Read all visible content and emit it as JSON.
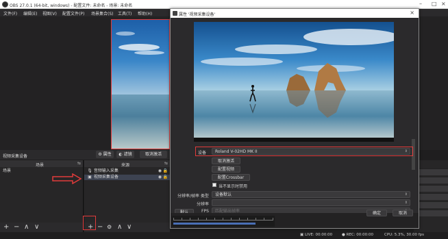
{
  "window": {
    "title": "OBS 27.0.1 (64-bit, windows) - 配置文件: 未命名 - 场景: 未命名"
  },
  "menu": [
    "文件(F)",
    "编辑(E)",
    "视图(V)",
    "配置文件(P)",
    "场景集合(S)",
    "工具(T)",
    "帮助(H)"
  ],
  "source_bar": {
    "label": "视频采集设备",
    "properties": "属性",
    "filters": "滤镜",
    "deactivate": "取消激活"
  },
  "scenes": {
    "header": "场景",
    "items": [
      "场景"
    ],
    "footer": [
      "+",
      "−",
      "∧",
      "∨"
    ]
  },
  "sources": {
    "header": "来源",
    "items": [
      {
        "label": "音频输入采集",
        "icon": "microphone-icon"
      },
      {
        "label": "视频采集设备",
        "icon": "camera-icon"
      }
    ],
    "footer": [
      "+",
      "−",
      "⚙",
      "∧",
      "∨"
    ]
  },
  "dialog": {
    "title": "属性 '视频采集设备'",
    "device_label": "设备",
    "device_value": "Roland V-02HD MK II",
    "buttons": [
      "取消激活",
      "配置视频",
      "配置Crossbar"
    ],
    "checkbox_label": "当不显示时禁用",
    "resolution_label": "分辨率/帧率 类型",
    "resolution_value": "设备默认",
    "res_label": "分辨率",
    "fps_label": "FPS",
    "fps_value": "匹配输出帧率",
    "defaults_button": "默认",
    "ok_button": "确定",
    "cancel_button": "取消"
  },
  "status": {
    "live": "LIVE: 00:00:00",
    "rec": "REC: 00:00:00",
    "cpu": "CPU: 5.3%, 30.00 fps"
  },
  "colors": {
    "highlight": "#e23b3b",
    "selection": "#3d4351"
  }
}
